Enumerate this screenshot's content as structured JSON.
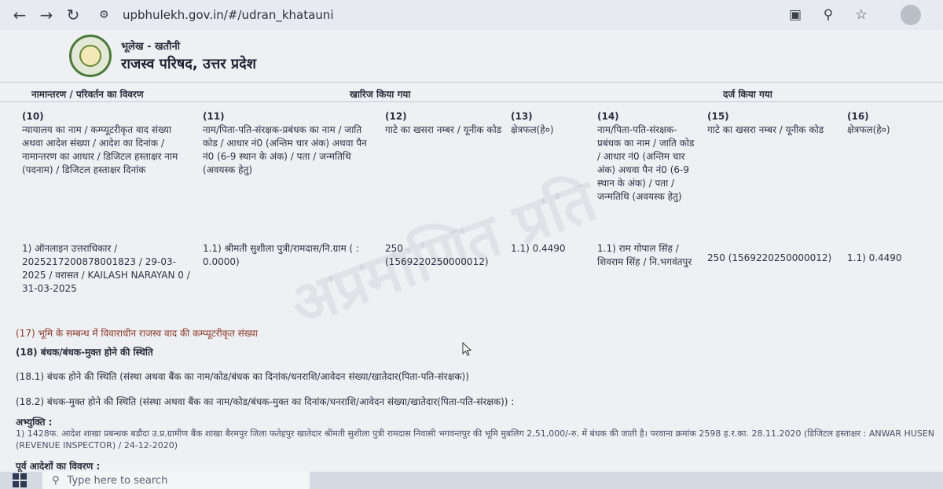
{
  "browser": {
    "url": "upbhulekh.gov.in/#/udran_khatauni",
    "icons": [
      "back-arrow-icon",
      "forward-arrow-icon",
      "reload-icon",
      "site-info-icon",
      "translate-icon",
      "zoom-icon",
      "star-icon",
      "profile-icon"
    ]
  },
  "header": {
    "subtitle": "भूलेख - खतौनी",
    "title": "राजस्व परिषद, उत्तर प्रदेश"
  },
  "table": {
    "group_headers": [
      "नामान्तरण / परिवर्तन का विवरण",
      "खारिज किया गया",
      "दर्ज किया गया"
    ],
    "columns": [
      {
        "num": "(10)",
        "label": "न्यायालय का नाम / कम्प्यूटरीकृत वाद संख्या अथवा आदेश संख्या / आदेश का दिनांक / नामान्तरण का आधार / डिजिटल हस्ताक्षर नाम (पदनाम) / डिजिटल हस्ताक्षर दिनांक"
      },
      {
        "num": "(11)",
        "label": "नाम/पिता-पति-संरक्षक-प्रबंधक का नाम / जाति कोड / आधार नं0 (अन्तिम चार अंक) अथवा पैन नं0 (6-9 स्थान के अंक) / पता / जन्मतिथि (अवयस्क हेतु)"
      },
      {
        "num": "(12)",
        "label": "गाटे का खसरा नम्बर / यूनीक कोड"
      },
      {
        "num": "(13)",
        "label": "क्षेत्रफल(हे०)"
      },
      {
        "num": "(14)",
        "label": "नाम/पिता-पति-संरक्षक-प्रबंधक का नाम / जाति कोड / आधार नं0 (अन्तिम चार अंक) अथवा पैन नं0 (6-9 स्थान के अंक) / पता / जन्मतिथि (अवयस्क हेतु)"
      },
      {
        "num": "(15)",
        "label": "गाटे का खसरा नम्बर / यूनीक कोड"
      },
      {
        "num": "(16)",
        "label": "क्षेत्रफल(हे०)"
      }
    ],
    "row": {
      "c10": "1) ऑनलाइन उत्तराधिकार / 2025217200878001823 / 29-03-2025 / वरासत / KAILASH NARAYAN 0 / 31-03-2025",
      "c11": "1.1) श्रीमती सुशीला पुत्री/रामदास/नि.ग्राम ( : 0.0000)",
      "c12": "250 (1569220250000012)",
      "c13": "1.1) 0.4490",
      "c14": "1.1) राम गोपाल सिंह / शिवराम सिंह / नि.भगवंतपुर",
      "c15": "250 (1569220250000012)",
      "c16": "1.1) 0.4490"
    }
  },
  "sections": {
    "s17": "(17) भूमि के सम्बन्ध में विवाराधीन राजस्व वाद की कम्प्यूटरीकृत संख्या",
    "s18": "(18) बंधक/बंधक-मुक्त होने की स्थिति",
    "s18_1": "(18.1) बंधक होने की स्थिति (संस्था अथवा बैंक का नाम/कोड/बंधक का दिनांक/धनराशि/आवेदन संख्या/खातेदार(पिता-पति-संरक्षक))",
    "s18_2": "(18.2) बंधक-मुक्त होने की स्थिति (संस्था अथवा बैंक का नाम/कोड/बंधक-मुक्त का दिनांक/धनराशि/आवेदन संख्या/खातेदार(पिता-पति-संरक्षक)) :",
    "remarks_heading": "अभ्युक्ति :",
    "remarks_text": "1) 1428फ. आदेश शाखा प्रबन्धक बडौदा उ.प्र.ग्रामीण बैंक शाखा बैरमपुर जिला फतेहपुर खातेदार श्रीमती सुशीला पुत्री रामदास निवासी भगवन्तपुर की भूमि मुबलिग 2,51,000/-रु. में बंधक की जाती है। परवाना क्रमांक 2598 ह.र.का. 28.11.2020 (डिजिटल हस्ताक्षर : ANWAR HUSEN (REVENUE INSPECTOR) / 24-12-2020)",
    "previous_orders": "पूर्व आदेशों का विवरण :"
  },
  "taskbar": {
    "search_placeholder": "Type here to search"
  }
}
